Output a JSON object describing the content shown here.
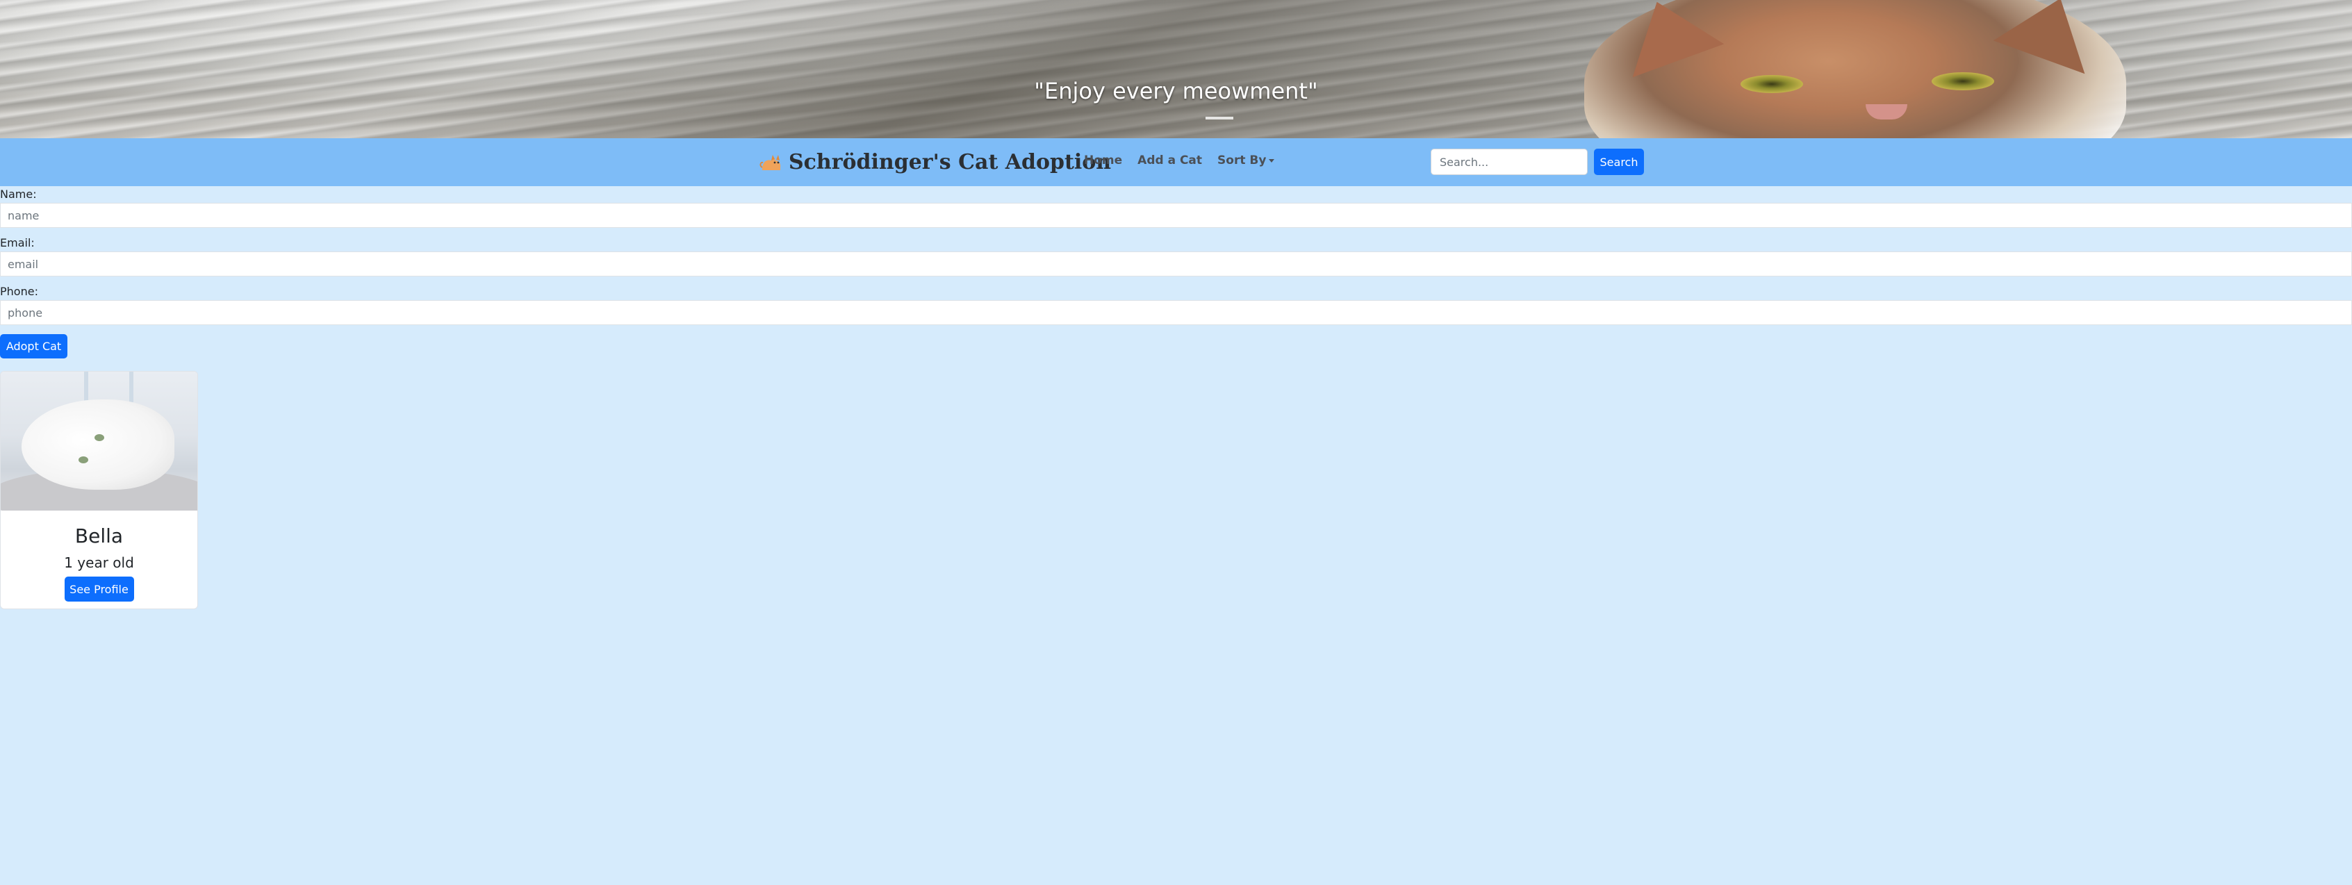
{
  "hero": {
    "quote": "\"Enjoy every meowment\""
  },
  "navbar": {
    "brand_icon": "cat-icon",
    "brand_text": "Schrödinger's Cat Adoption",
    "links": [
      {
        "label": "Home"
      },
      {
        "label": "Add a Cat"
      },
      {
        "label": "Sort By"
      }
    ],
    "search": {
      "placeholder": "Search...",
      "value": "",
      "button_label": "Search"
    },
    "background_color": "#7ebcf7"
  },
  "adopt_form": {
    "fields": [
      {
        "label": "Name:",
        "placeholder": "name",
        "value": ""
      },
      {
        "label": "Email:",
        "placeholder": "email",
        "value": ""
      },
      {
        "label": "Phone:",
        "placeholder": "phone",
        "value": ""
      }
    ],
    "submit_label": "Adopt Cat"
  },
  "cats": [
    {
      "name": "Bella",
      "age": "1 year old",
      "button_label": "See Profile"
    }
  ],
  "colors": {
    "page_background": "#d6ebfc",
    "primary": "#0d6efd"
  }
}
